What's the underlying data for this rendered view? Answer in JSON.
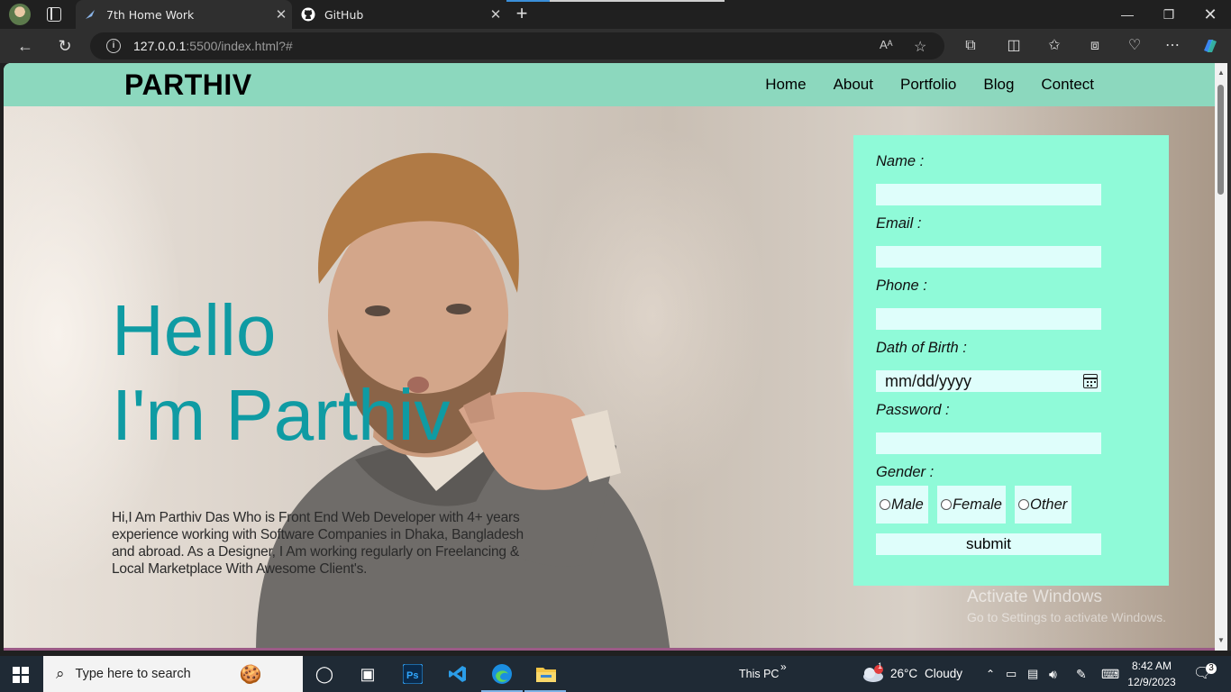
{
  "browser": {
    "tabs": [
      {
        "title": "7th Home Work",
        "active": true
      },
      {
        "title": "GitHub",
        "active": false
      }
    ],
    "address": {
      "host": "127.0.0.1",
      "path": ":5500/index.html?#"
    },
    "window_controls": [
      "minimize",
      "restore",
      "close"
    ]
  },
  "site": {
    "logo": "PARTHIV",
    "nav": [
      "Home",
      "About",
      "Portfolio",
      "Blog",
      "Contect"
    ],
    "hero": {
      "line1": "Hello",
      "line2": "I'm Parthiv",
      "bio": "Hi,I Am Parthiv Das Who is Front End Web Developer with 4+ years experience working with Software Companies in Dhaka, Bangladesh and abroad. As a Designer, I Am working regularly on Freelancing & Local Marketplace With Awesome Client's."
    },
    "form": {
      "name_label": "Name :",
      "email_label": "Email :",
      "phone_label": "Phone :",
      "dob_label": "Dath of Birth :",
      "dob_placeholder": "mm/dd/yyyy",
      "password_label": "Password :",
      "gender_label": "Gender :",
      "gender_options": [
        "Male",
        "Female",
        "Other"
      ],
      "submit_label": "submit"
    },
    "colors": {
      "navbar": "#8cd8be",
      "form": "#8ffad8",
      "input": "#dffefb",
      "hero_text": "#0f9ba3"
    }
  },
  "watermark": {
    "line1": "Activate Windows",
    "line2": "Go to Settings to activate Windows."
  },
  "taskbar": {
    "search_placeholder": "Type here to search",
    "this_pc": "This PC",
    "weather": {
      "temp": "26°C",
      "condition": "Cloudy",
      "badge": "1"
    },
    "time": "8:42 AM",
    "date": "12/9/2023",
    "notifications": "3"
  }
}
